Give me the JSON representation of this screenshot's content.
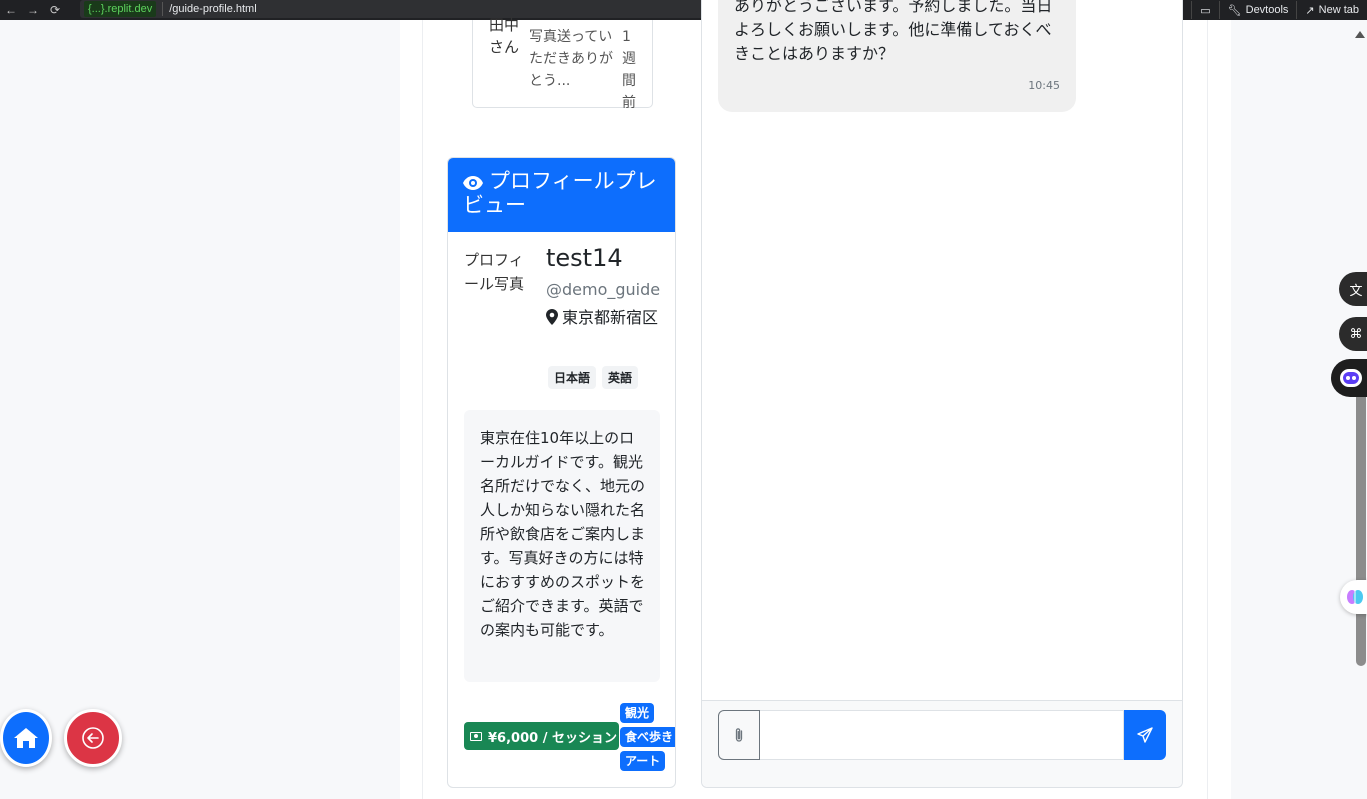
{
  "browser": {
    "replit_tag": "{...}.replit.dev",
    "url_path": "/guide-profile.html",
    "devtools_label": "Devtools",
    "new_tab_label": "New tab"
  },
  "conversation_item": {
    "avatar_alt": "田中さん",
    "preview": "写真送っていただきありがとう...",
    "time": "1週間前"
  },
  "profile_preview": {
    "header": "プロフィールプレビュー",
    "photo_alt": "プロフィール写真",
    "username": "test14",
    "handle": "@demo_guide",
    "location": "東京都新宿区",
    "languages": [
      "日本語",
      "英語"
    ],
    "bio": "東京在住10年以上のローカルガイドです。観光名所だけでなく、地元の人しか知らない隠れた名所や飲食店をご案内します。写真好きの方には特におすすめのスポットをご紹介できます。英語での案内も可能です。",
    "price": "¥6,000 / セッション",
    "tags": [
      "観光",
      "食べ歩き",
      "アート"
    ]
  },
  "chat": {
    "message_cut_line": "ありがとうございます。予約しました。当日",
    "message_body": "よろしくお願いします。他に準備しておくべきことはありますか？",
    "message_time": "10:45",
    "input_value": ""
  },
  "colors": {
    "primary": "#0d6efd",
    "success": "#198754",
    "danger": "#dc3545"
  }
}
